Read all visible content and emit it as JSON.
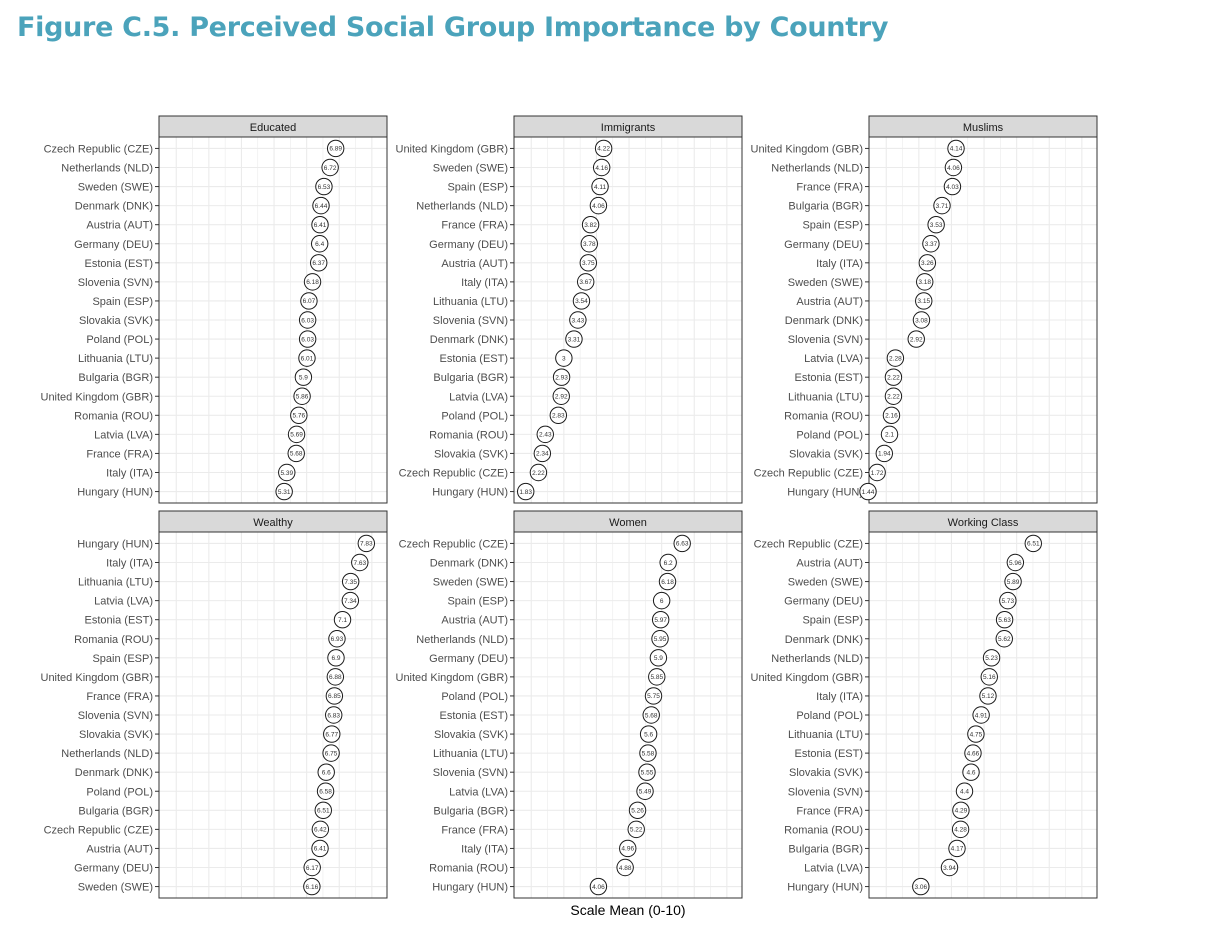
{
  "title": "Figure C.5. Perceived Social Group Importance by Country",
  "chart_data": {
    "type": "scatter",
    "title": "Figure C.5. Perceived Social Group Importance by Country",
    "xlabel": "Scale Mean (0-10)",
    "ylabel": "",
    "xlim": [
      1.44,
      7.9
    ],
    "grid": true,
    "x_ticks_shown": false,
    "colors": {
      "title": "#4ba3bb",
      "strip_fill": "#d9d9d9",
      "strip_border": "#333333",
      "grid": "#ebebeb",
      "point_stroke": "#1a1a1a"
    },
    "panels": [
      {
        "name": "Educated",
        "countries": [
          "Czech Republic (CZE)",
          "Netherlands (NLD)",
          "Sweden (SWE)",
          "Denmark (DNK)",
          "Austria (AUT)",
          "Germany (DEU)",
          "Estonia (EST)",
          "Slovenia (SVN)",
          "Spain (ESP)",
          "Slovakia (SVK)",
          "Poland (POL)",
          "Lithuania (LTU)",
          "Bulgaria (BGR)",
          "United Kingdom (GBR)",
          "Romania (ROU)",
          "Latvia (LVA)",
          "France (FRA)",
          "Italy (ITA)",
          "Hungary (HUN)"
        ],
        "values": [
          6.89,
          6.72,
          6.53,
          6.44,
          6.41,
          6.4,
          6.37,
          6.18,
          6.07,
          6.03,
          6.03,
          6.01,
          5.9,
          5.86,
          5.76,
          5.69,
          5.68,
          5.39,
          5.31
        ]
      },
      {
        "name": "Immigrants",
        "countries": [
          "United Kingdom (GBR)",
          "Sweden (SWE)",
          "Spain (ESP)",
          "Netherlands (NLD)",
          "France (FRA)",
          "Germany (DEU)",
          "Austria (AUT)",
          "Italy (ITA)",
          "Lithuania (LTU)",
          "Slovenia (SVN)",
          "Denmark (DNK)",
          "Estonia (EST)",
          "Bulgaria (BGR)",
          "Latvia (LVA)",
          "Poland (POL)",
          "Romania (ROU)",
          "Slovakia (SVK)",
          "Czech Republic (CZE)",
          "Hungary (HUN)"
        ],
        "values": [
          4.22,
          4.16,
          4.11,
          4.06,
          3.82,
          3.78,
          3.75,
          3.67,
          3.54,
          3.43,
          3.31,
          3,
          2.93,
          2.92,
          2.83,
          2.43,
          2.34,
          2.22,
          1.83
        ]
      },
      {
        "name": "Muslims",
        "countries": [
          "United Kingdom (GBR)",
          "Netherlands (NLD)",
          "France (FRA)",
          "Bulgaria (BGR)",
          "Spain (ESP)",
          "Germany (DEU)",
          "Italy (ITA)",
          "Sweden (SWE)",
          "Austria (AUT)",
          "Denmark (DNK)",
          "Slovenia (SVN)",
          "Latvia (LVA)",
          "Estonia (EST)",
          "Lithuania (LTU)",
          "Romania (ROU)",
          "Poland (POL)",
          "Slovakia (SVK)",
          "Czech Republic (CZE)",
          "Hungary (HUN)"
        ],
        "values": [
          4.14,
          4.06,
          4.03,
          3.71,
          3.53,
          3.37,
          3.26,
          3.18,
          3.15,
          3.08,
          2.92,
          2.28,
          2.22,
          2.22,
          2.16,
          2.1,
          1.94,
          1.72,
          1.44
        ]
      },
      {
        "name": "Wealthy",
        "countries": [
          "Hungary (HUN)",
          "Italy (ITA)",
          "Lithuania (LTU)",
          "Latvia (LVA)",
          "Estonia (EST)",
          "Romania (ROU)",
          "Spain (ESP)",
          "United Kingdom (GBR)",
          "France (FRA)",
          "Slovenia (SVN)",
          "Slovakia (SVK)",
          "Netherlands (NLD)",
          "Denmark (DNK)",
          "Poland (POL)",
          "Bulgaria (BGR)",
          "Czech Republic (CZE)",
          "Austria (AUT)",
          "Germany (DEU)",
          "Sweden (SWE)"
        ],
        "values": [
          7.83,
          7.63,
          7.35,
          7.34,
          7.1,
          6.93,
          6.9,
          6.88,
          6.85,
          6.83,
          6.77,
          6.75,
          6.6,
          6.58,
          6.51,
          6.42,
          6.41,
          6.17,
          6.16
        ]
      },
      {
        "name": "Women",
        "countries": [
          "Czech Republic (CZE)",
          "Denmark (DNK)",
          "Sweden (SWE)",
          "Spain (ESP)",
          "Austria (AUT)",
          "Netherlands (NLD)",
          "Germany (DEU)",
          "United Kingdom (GBR)",
          "Poland (POL)",
          "Estonia (EST)",
          "Slovakia (SVK)",
          "Lithuania (LTU)",
          "Slovenia (SVN)",
          "Latvia (LVA)",
          "Bulgaria (BGR)",
          "France (FRA)",
          "Italy (ITA)",
          "Romania (ROU)",
          "Hungary (HUN)"
        ],
        "values": [
          6.63,
          6.2,
          6.18,
          6,
          5.97,
          5.95,
          5.9,
          5.85,
          5.75,
          5.68,
          5.6,
          5.58,
          5.55,
          5.49,
          5.26,
          5.22,
          4.96,
          4.88,
          4.06
        ]
      },
      {
        "name": "Working Class",
        "countries": [
          "Czech Republic (CZE)",
          "Austria (AUT)",
          "Sweden (SWE)",
          "Germany (DEU)",
          "Spain (ESP)",
          "Denmark (DNK)",
          "Netherlands (NLD)",
          "United Kingdom (GBR)",
          "Italy (ITA)",
          "Poland (POL)",
          "Lithuania (LTU)",
          "Estonia (EST)",
          "Slovakia (SVK)",
          "Slovenia (SVN)",
          "France (FRA)",
          "Romania (ROU)",
          "Bulgaria (BGR)",
          "Latvia (LVA)",
          "Hungary (HUN)"
        ],
        "values": [
          6.51,
          5.96,
          5.89,
          5.73,
          5.63,
          5.62,
          5.23,
          5.16,
          5.12,
          4.91,
          4.75,
          4.66,
          4.6,
          4.4,
          4.29,
          4.28,
          4.17,
          3.94,
          3.06
        ]
      }
    ]
  }
}
